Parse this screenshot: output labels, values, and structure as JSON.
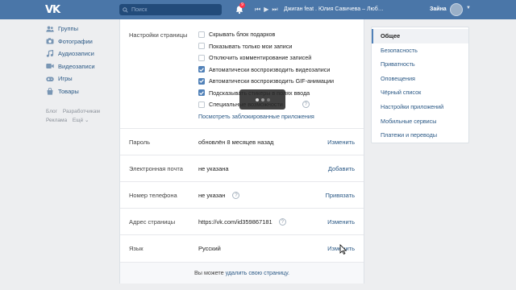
{
  "topbar": {
    "search_placeholder": "Поиск",
    "notifications_count": "9",
    "track_title": "Джиган feat . Юлия Савичева – Люб…",
    "username": "Зайна"
  },
  "leftnav": {
    "items": [
      {
        "label": "Группы",
        "icon": "groups-icon"
      },
      {
        "label": "Фотографии",
        "icon": "photos-icon"
      },
      {
        "label": "Аудиозаписи",
        "icon": "audio-icon"
      },
      {
        "label": "Видеозаписи",
        "icon": "video-icon"
      },
      {
        "label": "Игры",
        "icon": "games-icon"
      },
      {
        "label": "Товары",
        "icon": "goods-icon"
      }
    ],
    "footer": [
      "Блог",
      "Разработчикам",
      "Реклама",
      "Ещё ⌄"
    ]
  },
  "settings": {
    "section_label": "Настройки страницы",
    "checkboxes": [
      {
        "label": "Скрывать блок подарков",
        "checked": false
      },
      {
        "label": "Показывать только мои записи",
        "checked": false
      },
      {
        "label": "Отключить комментирование записей",
        "checked": false
      },
      {
        "label": "Автоматически воспроизводить видеозаписи",
        "checked": true
      },
      {
        "label": "Автоматически воспроизводить GIF-анимации",
        "checked": true
      },
      {
        "label": "Подсказывать стикеры в полях ввода",
        "checked": true
      },
      {
        "label": "Специальные возможности",
        "checked": false
      }
    ],
    "blocked_apps_link": "Посмотреть заблокированные приложения",
    "rows": [
      {
        "label": "Пароль",
        "value": "обновлён 8 месяцев назад",
        "action": "Изменить"
      },
      {
        "label": "Электронная почта",
        "value": "не указана",
        "action": "Добавить"
      },
      {
        "label": "Номер телефона",
        "value": "не указан",
        "action": "Привязать"
      },
      {
        "label": "Адрес страницы",
        "value": "https://vk.com/id359867181",
        "action": "Изменить"
      },
      {
        "label": "Язык",
        "value": "Русский",
        "action": "Изменить"
      }
    ],
    "delete_prefix": "Вы можете",
    "delete_link": "удалить свою страницу."
  },
  "rightnav": {
    "items": [
      "Общее",
      "Безопасность",
      "Приватность",
      "Оповещения",
      "Чёрный список",
      "Настройки приложений",
      "Мобильные сервисы",
      "Платежи и переводы"
    ],
    "active_index": 0
  },
  "colors": {
    "header": "#4a76a8",
    "link": "#2a5885",
    "checkbox_on": "#5181b8",
    "background": "#edeef0"
  }
}
